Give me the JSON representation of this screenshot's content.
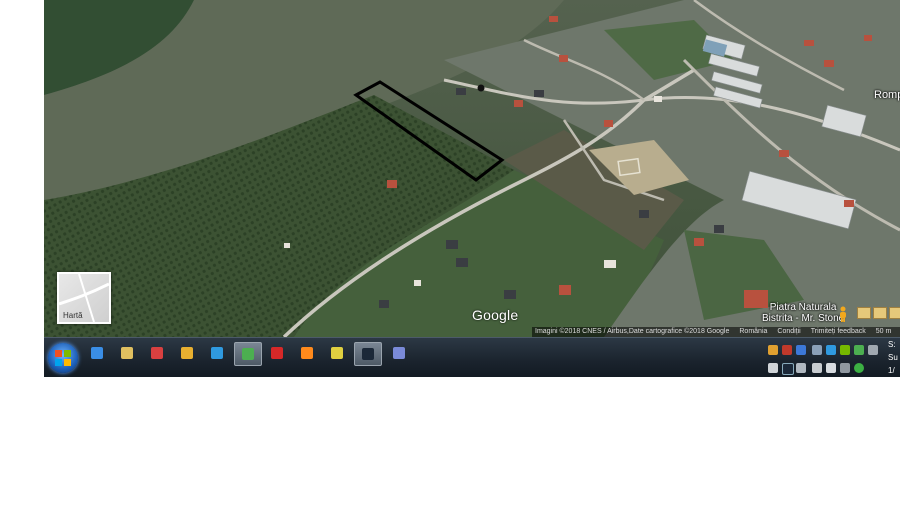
{
  "map": {
    "labels": {
      "rompetrol": "Romp",
      "piatra_line1": "Piatra Naturala",
      "piatra_line2": "Bistrita - Mr. Stone"
    },
    "google_logo": "Google",
    "attribution": {
      "imagery": "Imagini ©2018 CNES / Airbus,Date cartografice ©2018 Google",
      "country": "România",
      "terms": "Condiții",
      "feedback": "Trimiteți feedback",
      "scale": "50 m"
    },
    "map_type_tile": {
      "label": "Hartă"
    },
    "highlighted_parcel": {
      "outline_color": "#000000"
    },
    "colors": {
      "terrain": "#4a5d45",
      "road": "#c9c7bd",
      "roof_red": "#b8513e"
    }
  },
  "taskbar": {
    "apps": [
      {
        "name": "ie-icon",
        "color": "#3a8ee6"
      },
      {
        "name": "explorer-icon",
        "color": "#e0c060"
      },
      {
        "name": "app-flag-icon",
        "color": "#d84040"
      },
      {
        "name": "app-tools-icon",
        "color": "#e8b030"
      },
      {
        "name": "app-bolt-icon",
        "color": "#2f9ae0"
      },
      {
        "name": "chrome-icon",
        "color": "#4caf50",
        "active": true
      },
      {
        "name": "app-m-icon",
        "color": "#d62828"
      },
      {
        "name": "firefox-icon",
        "color": "#ff8a1c"
      },
      {
        "name": "app-chart-icon",
        "color": "#e0d040"
      },
      {
        "name": "steam-icon",
        "color": "#1b2838",
        "active": true
      },
      {
        "name": "app-window-icon",
        "color": "#7a8ad8"
      }
    ],
    "clock": {
      "line1": "S:",
      "line2": "Su",
      "line3": "1/"
    }
  }
}
